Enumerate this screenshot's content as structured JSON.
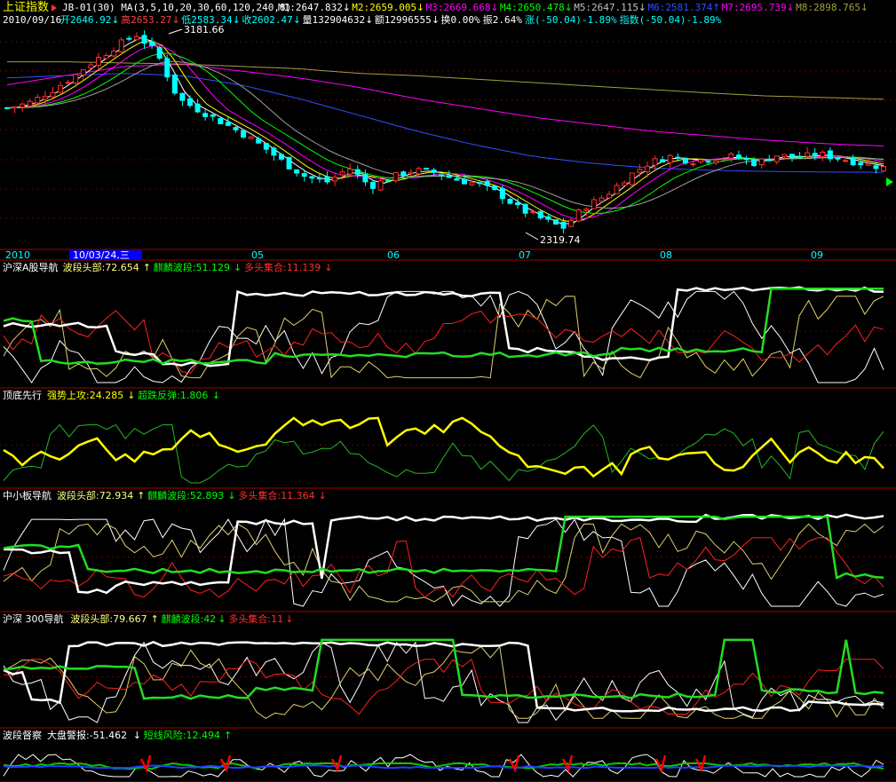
{
  "header": {
    "title": "上证指数",
    "indicator": "JB-01(30) MA(3,5,10,20,30,60,120,240,8)",
    "ma": [
      {
        "label": "M1:2647.832",
        "arrow": "↓",
        "color": "#ffffff"
      },
      {
        "label": "M2:2659.005",
        "arrow": "↓",
        "color": "#ffff00"
      },
      {
        "label": "M3:2669.668",
        "arrow": "↓",
        "color": "#ff00ff"
      },
      {
        "label": "M4:2650.478",
        "arrow": "↓",
        "color": "#00ff00"
      },
      {
        "label": "M5:2647.115",
        "arrow": "↓",
        "color": "#c0c0c0"
      },
      {
        "label": "M6:2581.374",
        "arrow": "↑",
        "color": "#3050ff"
      },
      {
        "label": "M7:2695.739",
        "arrow": "↓",
        "color": "#ff00ff"
      },
      {
        "label": "M8:2898.765",
        "arrow": "↓",
        "color": "#a0a040"
      }
    ],
    "date": "2010/09/16",
    "quote": [
      {
        "label": "开2646.92",
        "arrow": "↓",
        "color": "#00ffff"
      },
      {
        "label": "高2653.27",
        "arrow": "↓",
        "color": "#ff4040"
      },
      {
        "label": "低2583.34",
        "arrow": "↓",
        "color": "#00ffff"
      },
      {
        "label": "收2602.47",
        "arrow": "↓",
        "color": "#00ffff"
      },
      {
        "label": "量132904632",
        "arrow": "↓",
        "color": "#ffffff"
      },
      {
        "label": "额12996555",
        "arrow": "↓",
        "color": "#ffffff"
      },
      {
        "label": "换0.00%",
        "arrow": "",
        "color": "#ffffff"
      },
      {
        "label": "振2.64%",
        "arrow": "",
        "color": "#ffffff"
      },
      {
        "label": "涨(-50.04)-1.89%",
        "arrow": "",
        "color": "#00ffff"
      },
      {
        "label": "指数(-50.04)-1.89%",
        "arrow": "",
        "color": "#00ffff"
      }
    ]
  },
  "annotations": {
    "high_label": "3181.66",
    "low_label": "2319.74"
  },
  "time_axis": {
    "labels": [
      "2010",
      "05",
      "06",
      "07",
      "08",
      "09"
    ],
    "cursor_label": "10/03/24,三"
  },
  "panels": [
    {
      "name": "沪深A股导航",
      "items": [
        {
          "label": "波段头部:72.654",
          "arrow": "↑",
          "color": "#ffff80"
        },
        {
          "label": "麒麟波段:51.129",
          "arrow": "↓",
          "color": "#00ff00"
        },
        {
          "label": "多头集合:11.139",
          "arrow": "↓",
          "color": "#ff3030"
        }
      ]
    },
    {
      "name": "顶底先行",
      "items": [
        {
          "label": "强势上攻:24.285",
          "arrow": "↓",
          "color": "#ffff00"
        },
        {
          "label": "超跌反弹:1.806",
          "arrow": "↓",
          "color": "#00ff00"
        }
      ]
    },
    {
      "name": "中小板导航",
      "items": [
        {
          "label": "波段头部:72.934",
          "arrow": "↑",
          "color": "#ffff80"
        },
        {
          "label": "麒麟波段:52.893",
          "arrow": "↓",
          "color": "#00ff00"
        },
        {
          "label": "多头集合:11.364",
          "arrow": "↓",
          "color": "#ff3030"
        }
      ]
    },
    {
      "name": "沪深 300导航",
      "items": [
        {
          "label": "波段头部:79.667",
          "arrow": "↑",
          "color": "#ffff80"
        },
        {
          "label": "麒麟波段:42",
          "arrow": "↓",
          "color": "#00ff00"
        },
        {
          "label": "多头集合:11",
          "arrow": "↓",
          "color": "#ff3030"
        }
      ]
    },
    {
      "name": "波段督察",
      "items": [
        {
          "label": "大盘警报:-51.462",
          "arrow": "↓",
          "color": "#ffffff"
        },
        {
          "label": "短线风险:12.494",
          "arrow": "↑",
          "color": "#00ff00"
        }
      ]
    }
  ],
  "chart_data": {
    "type": "line",
    "title": "上证指数",
    "x_range": [
      "2010-03-24",
      "2010-09-16"
    ],
    "y_range": [
      2319.74,
      3181.66
    ],
    "high": 3181.66,
    "low": 2319.74,
    "close_series_approx": [
      2860,
      2880,
      2930,
      2990,
      3060,
      3120,
      3181,
      3100,
      2900,
      2850,
      2800,
      2750,
      2690,
      2620,
      2560,
      2540,
      2600,
      2520,
      2560,
      2590,
      2580,
      2550,
      2530,
      2490,
      2420,
      2380,
      2340,
      2430,
      2480,
      2560,
      2620,
      2650,
      2630,
      2640,
      2650,
      2620,
      2655,
      2645,
      2660,
      2640,
      2620,
      2602
    ],
    "ma_lines": [
      {
        "name": "M7",
        "color": "#ff00ff",
        "values": [
          2960,
          3000,
          3040,
          3050,
          3020,
          2990,
          2950,
          2900,
          2860,
          2820,
          2790,
          2760,
          2740,
          2720,
          2705,
          2695
        ]
      },
      {
        "name": "M8",
        "color": "#a0a040",
        "values": [
          3060,
          3060,
          3055,
          3050,
          3040,
          3030,
          3010,
          3000,
          2985,
          2970,
          2955,
          2940,
          2925,
          2912,
          2905,
          2898
        ]
      },
      {
        "name": "M6",
        "color": "#3050ff",
        "values": [
          2990,
          3000,
          3010,
          3000,
          2960,
          2900,
          2830,
          2760,
          2700,
          2650,
          2620,
          2600,
          2590,
          2585,
          2582,
          2581
        ]
      }
    ],
    "legend": "top",
    "grid": true
  }
}
